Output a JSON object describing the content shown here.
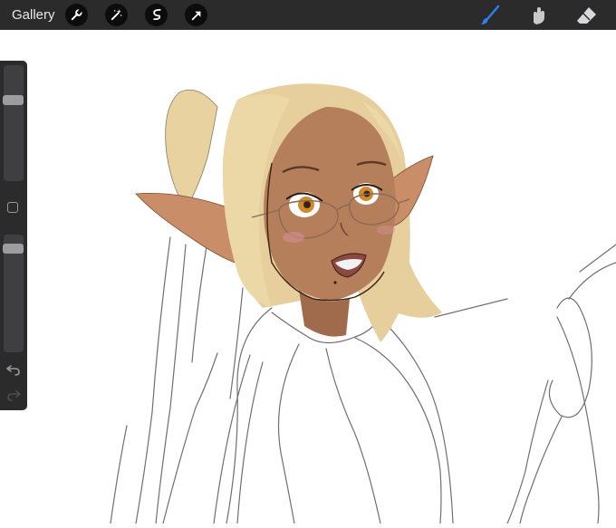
{
  "toolbar": {
    "gallery_label": "Gallery",
    "left_tools": [
      "wrench-icon",
      "magic-wand-icon",
      "selection-icon",
      "transform-arrow-icon"
    ],
    "right_tools": [
      "brush-icon",
      "smudge-icon",
      "eraser-icon"
    ],
    "active_tool": "brush-icon"
  },
  "colors": {
    "toolbar_bg": "#2b2b2c",
    "active_accent": "#2f7ff3",
    "canvas_bg": "#ffffff",
    "skin": "#b57f5c",
    "hair": "#e6cf9d"
  },
  "sidebar": {
    "brush_size_level": 0.72,
    "opacity_level": 0.92,
    "controls": [
      "brush-size-slider",
      "modify-button",
      "opacity-slider",
      "undo-icon",
      "redo-icon"
    ]
  }
}
